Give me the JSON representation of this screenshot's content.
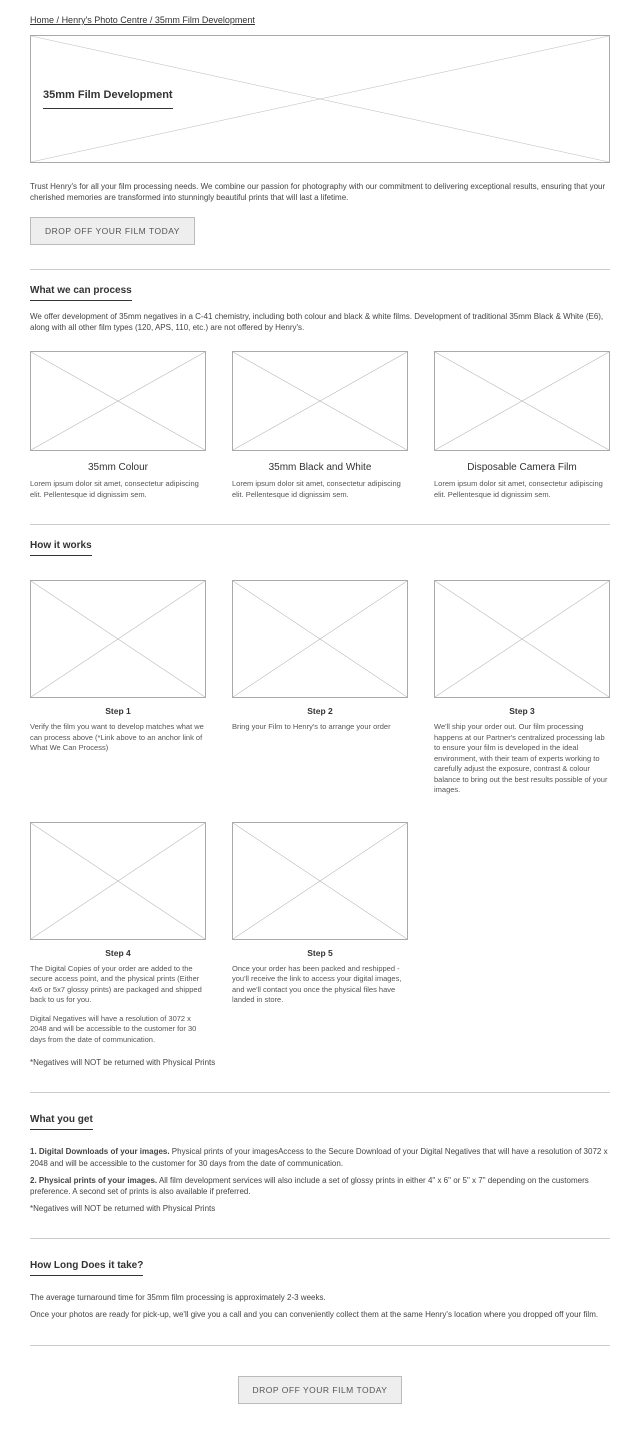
{
  "breadcrumb": {
    "home": "Home",
    "centre": "Henry's Photo Centre",
    "page": "35mm Film Development",
    "sep": "/"
  },
  "hero": {
    "title": "35mm Film Development"
  },
  "intro": "Trust Henry's for all your film processing needs. We combine our passion for photography with our commitment to delivering exceptional results, ensuring that your cherished memories are transformed into stunningly beautiful prints that will last a lifetime.",
  "cta_label": "DROP OFF YOUR FILM TODAY",
  "process": {
    "heading": "What we can process",
    "body": "We offer development of 35mm negatives in a C-41 chemistry, including both colour and black & white films. Development of traditional 35mm Black & White (E6), along with all other film types (120, APS, 110, etc.) are not offered by Henry's.",
    "items": [
      {
        "title": "35mm Colour",
        "desc": "Lorem ipsum dolor sit amet, consectetur adipiscing elit. Pellentesque id dignissim sem."
      },
      {
        "title": "35mm Black and White",
        "desc": "Lorem ipsum dolor sit amet, consectetur adipiscing elit. Pellentesque id dignissim sem."
      },
      {
        "title": "Disposable Camera Film",
        "desc": "Lorem ipsum dolor sit amet, consectetur adipiscing elit. Pellentesque id dignissim sem."
      }
    ]
  },
  "how": {
    "heading": "How it works",
    "steps": [
      {
        "label": "Step 1",
        "desc": "Verify the film you want to develop matches what we can process above (*Link above to an anchor link of What We Can Process)"
      },
      {
        "label": "Step 2",
        "desc": "Bring your Film to Henry's to arrange your order"
      },
      {
        "label": "Step 3",
        "desc": "We'll ship your order out. Our film processing happens at our Partner's centralized processing lab to ensure your film is developed in the ideal environment, with their team of experts working to carefully adjust the exposure, contrast & colour balance to bring out the best results possible of your images."
      },
      {
        "label": "Step 4",
        "desc": "The Digital Copies of your order are added to the secure access point, and the physical prints (Either 4x6 or 5x7 glossy prints) are packaged and shipped back to us for you.",
        "desc2": "Digital Negatives will have a resolution of 3072 x 2048 and will be accessible to the customer for 30 days from the date of communication."
      },
      {
        "label": "Step 5",
        "desc": "Once your order has been packed and reshipped - you'll receive the link to access your digital images, and we'll contact you once the physical files have landed in store."
      }
    ],
    "note": "*Negatives will NOT be returned with Physical Prints"
  },
  "get": {
    "heading": "What you get",
    "p1_bold": "1. Digital Downloads of your images.",
    "p1": " Physical prints of your imagesAccess to the Secure Download of your Digital Negatives that will have a resolution of 3072 x 2048 and will be accessible to the customer for 30 days from the date of communication.",
    "p2_bold": "2. Physical prints of your images.",
    "p2": " All film development services will also include a set of glossy prints in either 4\" x 6\" or 5\" x 7\" depending on the customers preference. A second set of prints is also available if preferred.",
    "note": "*Negatives will NOT be returned with Physical Prints"
  },
  "long": {
    "heading": "How Long Does it take?",
    "p1": "The average turnaround time for 35mm film processing is approximately 2-3 weeks.",
    "p2": "Once your photos are ready for pick-up, we'll give you a call and you can conveniently collect them at the same Henry's location where you dropped off your film."
  }
}
